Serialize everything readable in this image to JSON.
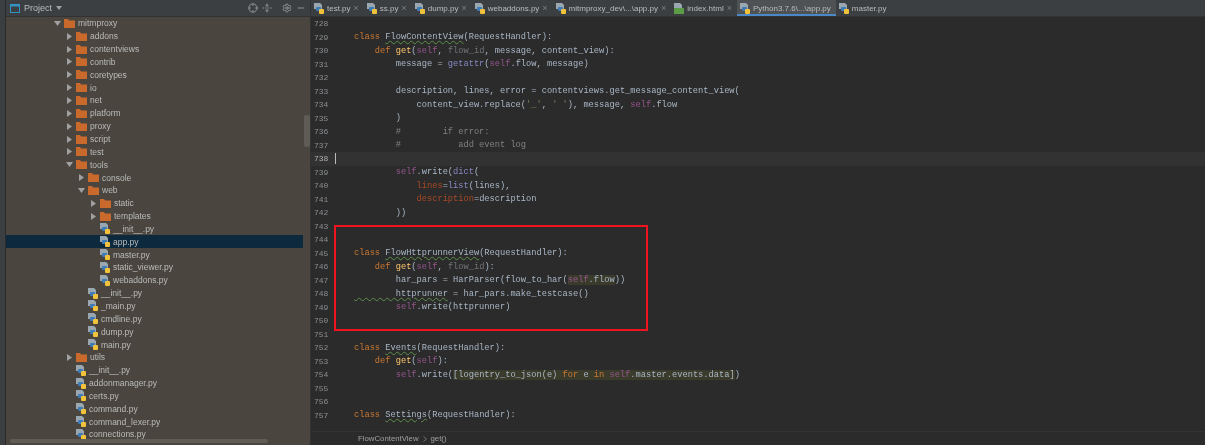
{
  "project_panel": {
    "title": "Project",
    "tree": [
      {
        "name": "mitmproxy",
        "kind": "folder",
        "expanded": true,
        "selected": false,
        "children": [
          {
            "name": "addons",
            "kind": "folder",
            "expanded": false,
            "selected": false
          },
          {
            "name": "contentviews",
            "kind": "folder",
            "expanded": false,
            "selected": false
          },
          {
            "name": "contrib",
            "kind": "folder",
            "expanded": false,
            "selected": false
          },
          {
            "name": "coretypes",
            "kind": "folder",
            "expanded": false,
            "selected": false
          },
          {
            "name": "io",
            "kind": "folder",
            "expanded": false,
            "selected": false
          },
          {
            "name": "net",
            "kind": "folder",
            "expanded": false,
            "selected": false
          },
          {
            "name": "platform",
            "kind": "folder",
            "expanded": false,
            "selected": false
          },
          {
            "name": "proxy",
            "kind": "folder",
            "expanded": false,
            "selected": false
          },
          {
            "name": "script",
            "kind": "folder",
            "expanded": false,
            "selected": false
          },
          {
            "name": "test",
            "kind": "folder",
            "expanded": false,
            "selected": false
          },
          {
            "name": "tools",
            "kind": "folder",
            "expanded": true,
            "selected": false,
            "children": [
              {
                "name": "console",
                "kind": "folder",
                "expanded": false,
                "selected": false
              },
              {
                "name": "web",
                "kind": "folder",
                "expanded": true,
                "selected": false,
                "children": [
                  {
                    "name": "static",
                    "kind": "folder",
                    "expanded": false,
                    "selected": false
                  },
                  {
                    "name": "templates",
                    "kind": "folder",
                    "expanded": false,
                    "selected": false
                  },
                  {
                    "name": "__init__.py",
                    "kind": "file",
                    "selected": false
                  },
                  {
                    "name": "app.py",
                    "kind": "file",
                    "selected": true
                  },
                  {
                    "name": "master.py",
                    "kind": "file",
                    "selected": false
                  },
                  {
                    "name": "static_viewer.py",
                    "kind": "file",
                    "selected": false
                  },
                  {
                    "name": "webaddons.py",
                    "kind": "file",
                    "selected": false
                  }
                ]
              },
              {
                "name": "__init__.py",
                "kind": "file",
                "selected": false
              },
              {
                "name": "_main.py",
                "kind": "file",
                "selected": false
              },
              {
                "name": "cmdline.py",
                "kind": "file",
                "selected": false
              },
              {
                "name": "dump.py",
                "kind": "file",
                "selected": false
              },
              {
                "name": "main.py",
                "kind": "file",
                "selected": false
              }
            ]
          },
          {
            "name": "utils",
            "kind": "folder",
            "expanded": false,
            "selected": false
          },
          {
            "name": "__init__.py",
            "kind": "file",
            "selected": false
          },
          {
            "name": "addonmanager.py",
            "kind": "file",
            "selected": false
          },
          {
            "name": "certs.py",
            "kind": "file",
            "selected": false
          },
          {
            "name": "command.py",
            "kind": "file",
            "selected": false
          },
          {
            "name": "command_lexer.py",
            "kind": "file",
            "selected": false
          },
          {
            "name": "connections.py",
            "kind": "file",
            "selected": false
          }
        ]
      }
    ]
  },
  "tabs": [
    {
      "label": "test.py",
      "kind": "python",
      "selected": false,
      "close": "×"
    },
    {
      "label": "ss.py",
      "kind": "python",
      "selected": false,
      "close": "×"
    },
    {
      "label": "dump.py",
      "kind": "python",
      "selected": false,
      "close": "×"
    },
    {
      "label": "webaddons.py",
      "kind": "python",
      "selected": false,
      "close": "×"
    },
    {
      "label": "mitmproxy_dev\\...\\app.py",
      "kind": "python",
      "selected": false,
      "close": "×"
    },
    {
      "label": "index.html",
      "kind": "html",
      "selected": false,
      "close": "×"
    },
    {
      "label": "Python3.7.6\\...\\app.py",
      "kind": "python",
      "selected": true
    },
    {
      "label": "master.py",
      "kind": "python",
      "selected": false
    }
  ],
  "editor": {
    "blocks": [
      {
        "kind": "plain",
        "lines": [
          {
            "number": "728",
            "kind": "code"
          },
          {
            "number": "729",
            "kind": "code",
            "tokens": [
              {
                "kind": "keyword",
                "text": "class "
              },
              {
                "kind": "flagged",
                "text": "FlowContentView"
              },
              {
                "kind": "plain",
                "text": "(RequestHandler):"
              }
            ]
          },
          {
            "number": "730",
            "kind": "code",
            "tokens": [
              {
                "kind": "keyword",
                "text": "    def "
              },
              {
                "kind": "def_name",
                "text": "get"
              },
              {
                "kind": "plain",
                "text": "("
              },
              {
                "kind": "self",
                "text": "self"
              },
              {
                "kind": "plain",
                "text": ", "
              },
              {
                "kind": "unused",
                "text": "flow_id"
              },
              {
                "kind": "plain",
                "text": ", message, content_view):"
              }
            ]
          },
          {
            "number": "731",
            "kind": "code",
            "tokens": [
              {
                "kind": "plain",
                "text": "        message = "
              },
              {
                "kind": "builtin",
                "text": "getattr"
              },
              {
                "kind": "plain",
                "text": "("
              },
              {
                "kind": "self",
                "text": "self"
              },
              {
                "kind": "plain",
                "text": ".flow, message)"
              }
            ]
          },
          {
            "number": "732",
            "kind": "code"
          },
          {
            "number": "733",
            "kind": "code",
            "tokens": [
              {
                "kind": "plain",
                "text": "        description, lines, error = contentviews.get_message_content_view("
              }
            ]
          },
          {
            "number": "734",
            "kind": "code",
            "tokens": [
              {
                "kind": "plain",
                "text": "            content_view.replace("
              },
              {
                "kind": "string",
                "text": "'_'"
              },
              {
                "kind": "plain",
                "text": ", "
              },
              {
                "kind": "string",
                "text": "' '"
              },
              {
                "kind": "plain",
                "text": "), message, "
              },
              {
                "kind": "self",
                "text": "self"
              },
              {
                "kind": "plain",
                "text": ".flow"
              }
            ]
          },
          {
            "number": "735",
            "kind": "code",
            "tokens": [
              {
                "kind": "plain",
                "text": "        )"
              }
            ]
          },
          {
            "number": "736",
            "kind": "code",
            "tokens": [
              {
                "kind": "comment",
                "text": "        #        if error:"
              }
            ]
          },
          {
            "number": "737",
            "kind": "code",
            "tokens": [
              {
                "kind": "comment",
                "text": "        #           add event log"
              }
            ]
          },
          {
            "number": "738",
            "kind": "caret"
          },
          {
            "number": "739",
            "kind": "code",
            "tokens": [
              {
                "kind": "self",
                "text": "        self"
              },
              {
                "kind": "plain",
                "text": ".write("
              },
              {
                "kind": "builtin",
                "text": "dict"
              },
              {
                "kind": "plain",
                "text": "("
              }
            ]
          },
          {
            "number": "740",
            "kind": "code",
            "tokens": [
              {
                "kind": "kwarg",
                "text": "            lines"
              },
              {
                "kind": "plain",
                "text": "="
              },
              {
                "kind": "builtin",
                "text": "list"
              },
              {
                "kind": "plain",
                "text": "(lines),"
              }
            ]
          },
          {
            "number": "741",
            "kind": "code",
            "tokens": [
              {
                "kind": "kwarg",
                "text": "            description"
              },
              {
                "kind": "plain",
                "text": "=description"
              }
            ]
          },
          {
            "number": "742",
            "kind": "code",
            "tokens": [
              {
                "kind": "plain",
                "text": "        ))"
              }
            ]
          }
        ]
      },
      {
        "kind": "boxed",
        "lines": [
          {
            "number": "743",
            "kind": "code"
          },
          {
            "number": "744",
            "kind": "code"
          },
          {
            "number": "745",
            "kind": "code",
            "tokens": [
              {
                "kind": "keyword",
                "text": "class "
              },
              {
                "kind": "flagged",
                "text": "FlowHttprunnerView"
              },
              {
                "kind": "plain",
                "text": "(RequestHandler):"
              }
            ]
          },
          {
            "number": "746",
            "kind": "code",
            "tokens": [
              {
                "kind": "keyword",
                "text": "    def "
              },
              {
                "kind": "def_name",
                "text": "get"
              },
              {
                "kind": "plain",
                "text": "("
              },
              {
                "kind": "self",
                "text": "self"
              },
              {
                "kind": "plain",
                "text": ", "
              },
              {
                "kind": "unused",
                "text": "flow_id"
              },
              {
                "kind": "plain",
                "text": "):"
              }
            ]
          },
          {
            "number": "747",
            "kind": "code",
            "tokens": [
              {
                "kind": "plain",
                "text": "        har_pars = HarParser(flow_to_har("
              },
              {
                "kind": "highlight",
                "tokens": [
                  {
                    "kind": "self",
                    "text": "self"
                  },
                  {
                    "kind": "plain",
                    "text": ".flow"
                  }
                ]
              },
              {
                "kind": "plain",
                "text": "))"
              }
            ]
          },
          {
            "number": "748",
            "kind": "code",
            "tokens": [
              {
                "kind": "flagged",
                "text": "        httprunner"
              },
              {
                "kind": "plain",
                "text": " = har_pars.make_testcase()"
              }
            ]
          },
          {
            "number": "749",
            "kind": "code",
            "tokens": [
              {
                "kind": "self",
                "text": "        self"
              },
              {
                "kind": "plain",
                "text": ".write(httprunner)"
              }
            ]
          },
          {
            "number": "750",
            "kind": "code"
          }
        ]
      },
      {
        "kind": "plain",
        "lines": [
          {
            "number": "751",
            "kind": "code"
          },
          {
            "number": "752",
            "kind": "code",
            "tokens": [
              {
                "kind": "keyword",
                "text": "class "
              },
              {
                "kind": "flagged",
                "text": "Events"
              },
              {
                "kind": "plain",
                "text": "(RequestHandler):"
              }
            ]
          },
          {
            "number": "753",
            "kind": "code",
            "tokens": [
              {
                "kind": "keyword",
                "text": "    def "
              },
              {
                "kind": "def_name",
                "text": "get"
              },
              {
                "kind": "plain",
                "text": "("
              },
              {
                "kind": "self",
                "text": "self"
              },
              {
                "kind": "plain",
                "text": "):"
              }
            ]
          },
          {
            "number": "754",
            "kind": "code",
            "tokens": [
              {
                "kind": "self",
                "text": "        self"
              },
              {
                "kind": "plain",
                "text": ".write("
              },
              {
                "kind": "highlight",
                "tokens": [
                  {
                    "kind": "plain",
                    "text": "[logentry_to_json(e) "
                  },
                  {
                    "kind": "keyword",
                    "text": "for"
                  },
                  {
                    "kind": "plain",
                    "text": " e "
                  },
                  {
                    "kind": "keyword",
                    "text": "in"
                  },
                  {
                    "kind": "self",
                    "text": " self"
                  },
                  {
                    "kind": "plain",
                    "text": ".master.events.data]"
                  }
                ]
              },
              {
                "kind": "plain",
                "text": ")"
              }
            ]
          },
          {
            "number": "755",
            "kind": "code"
          },
          {
            "number": "756",
            "kind": "code"
          },
          {
            "number": "757",
            "kind": "code",
            "tokens": [
              {
                "kind": "keyword",
                "text": "class "
              },
              {
                "kind": "flagged",
                "text": "Settings"
              },
              {
                "kind": "plain",
                "text": "(RequestHandler):"
              }
            ]
          }
        ]
      }
    ]
  },
  "breadcrumbs": [
    "FlowContentView",
    "get()"
  ]
}
